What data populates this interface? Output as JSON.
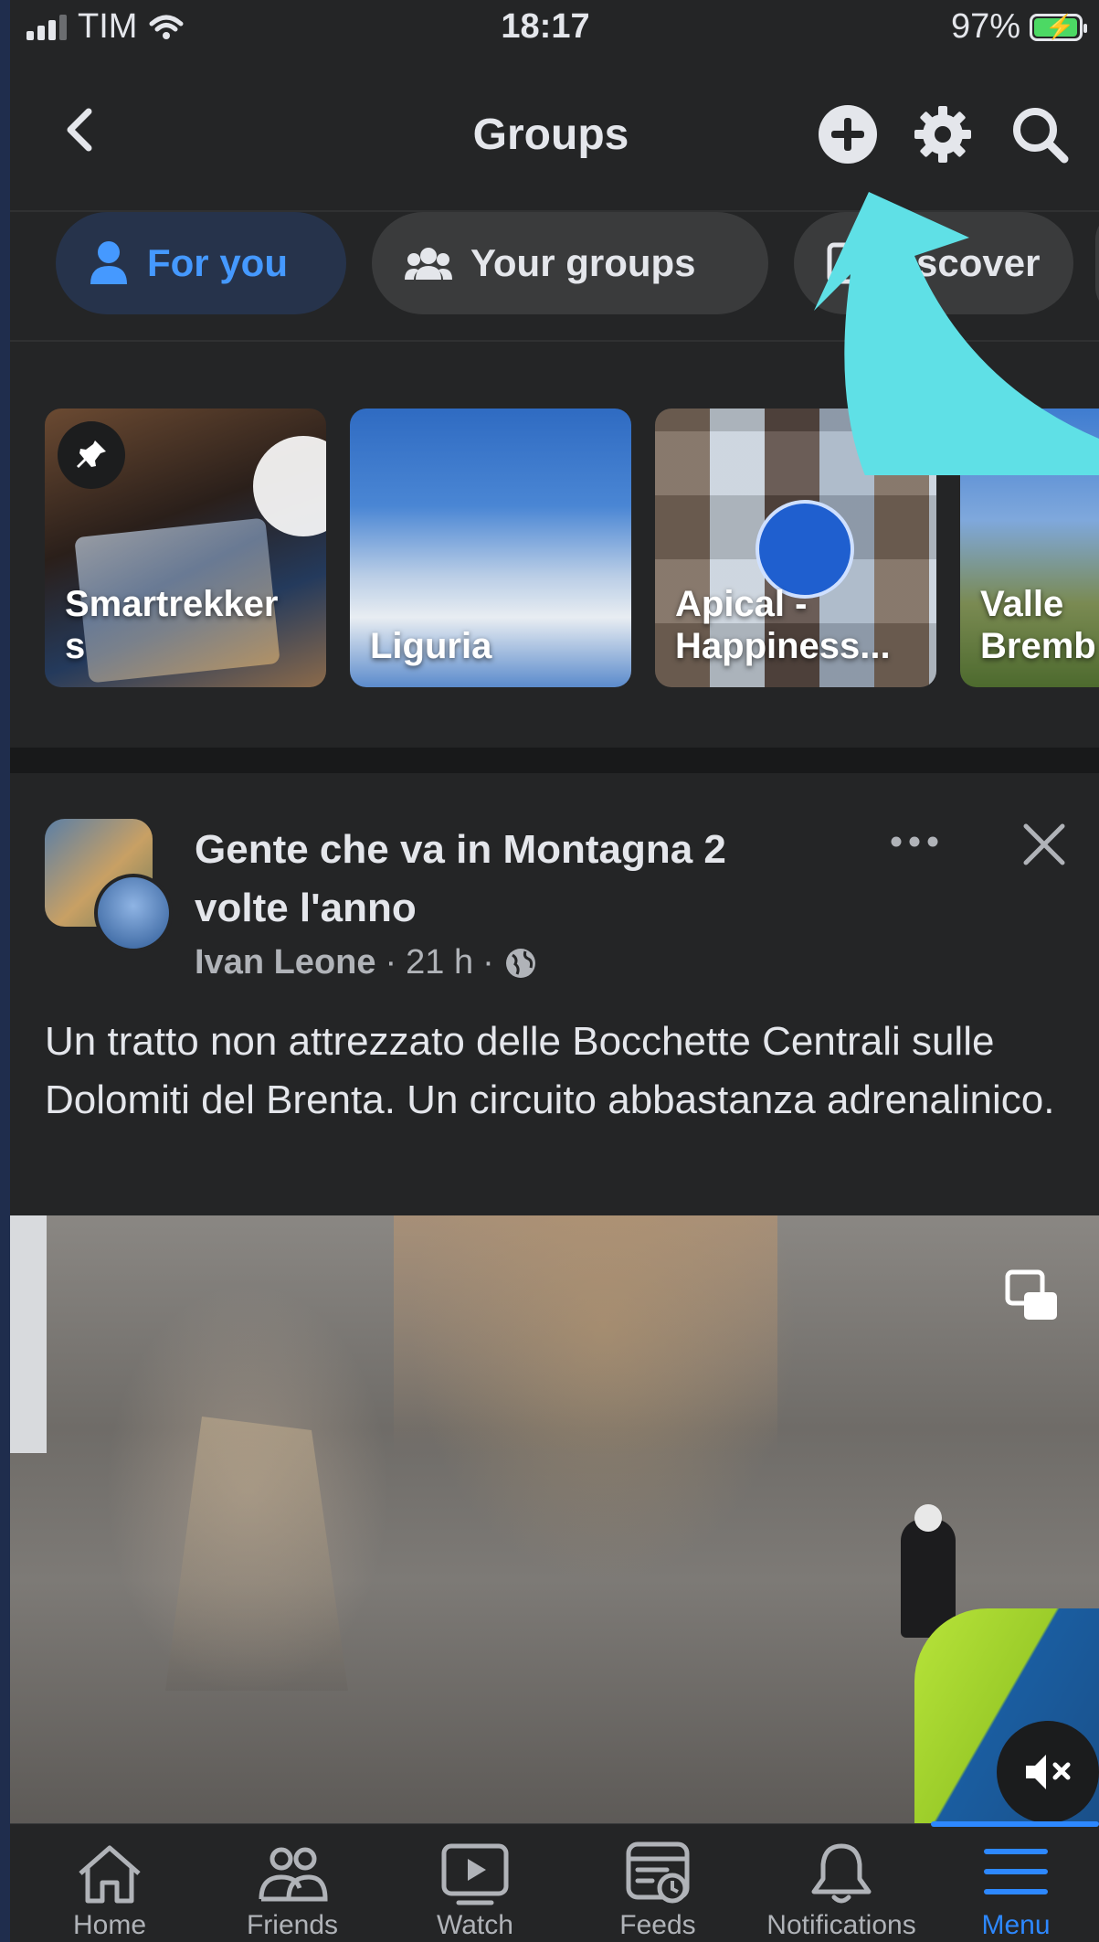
{
  "status_bar": {
    "carrier": "TIM",
    "time": "18:17",
    "battery": "97%"
  },
  "header": {
    "title": "Groups"
  },
  "chips": [
    {
      "label": "For you",
      "active": true
    },
    {
      "label": "Your groups",
      "active": false
    },
    {
      "label": "Discover",
      "active": false
    }
  ],
  "group_tiles": [
    {
      "name": "Smartrekker\ns",
      "pinned": true
    },
    {
      "name": "Liguria",
      "pinned": false
    },
    {
      "name": "Apical -\nHappiness...",
      "pinned": false
    },
    {
      "name": "Valle\nBremb",
      "pinned": false
    }
  ],
  "post": {
    "group": "Gente che va in Montagna 2 volte l'anno",
    "author": "Ivan Leone",
    "separator": "·",
    "time": "21 h",
    "text": "Un tratto non attrezzato delle Bocchette Centrali sulle Dolomiti del Brenta. Un circuito abbastanza adrenalinico."
  },
  "tab_bar": [
    {
      "label": "Home",
      "icon": "home-icon"
    },
    {
      "label": "Friends",
      "icon": "friends-icon"
    },
    {
      "label": "Watch",
      "icon": "watch-icon"
    },
    {
      "label": "Feeds",
      "icon": "feeds-icon"
    },
    {
      "label": "Notifications",
      "icon": "bell-icon"
    },
    {
      "label": "Menu",
      "icon": "menu-icon",
      "active": true
    }
  ],
  "colors": {
    "background": "#242526",
    "accent": "#2d88ff",
    "annotation_arrow": "#5fe0e6"
  }
}
